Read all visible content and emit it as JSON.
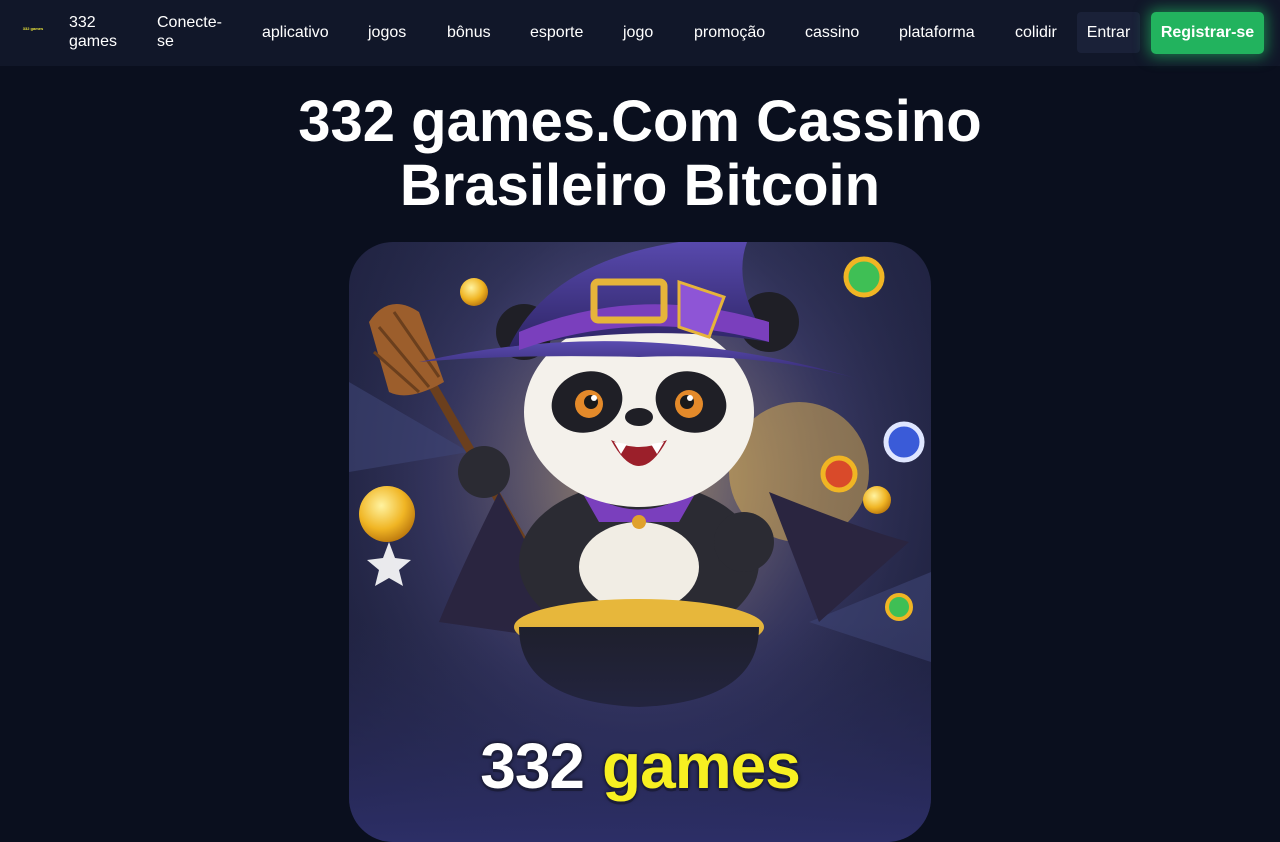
{
  "header": {
    "logo_text": "332 games",
    "nav": [
      {
        "label": "332\ngames"
      },
      {
        "label": "Conecte-\nse"
      },
      {
        "label": "aplicativo"
      },
      {
        "label": "jogos"
      },
      {
        "label": "bônus"
      },
      {
        "label": "esporte"
      },
      {
        "label": "jogo"
      },
      {
        "label": "promoção"
      },
      {
        "label": "cassino"
      },
      {
        "label": "plataforma"
      },
      {
        "label": "colidir"
      }
    ],
    "login_label": "Entrar",
    "register_label": "Registrar-se"
  },
  "main": {
    "title": "332 games.Com Cassino Brasileiro Bitcoin",
    "hero": {
      "brand_number": "332",
      "brand_word": "games",
      "icon": "panda-wizard-icon"
    }
  },
  "colors": {
    "background": "#0a0f1e",
    "navbar": "#111729",
    "register_button": "#22b35e",
    "brand_yellow": "#f7f021"
  }
}
